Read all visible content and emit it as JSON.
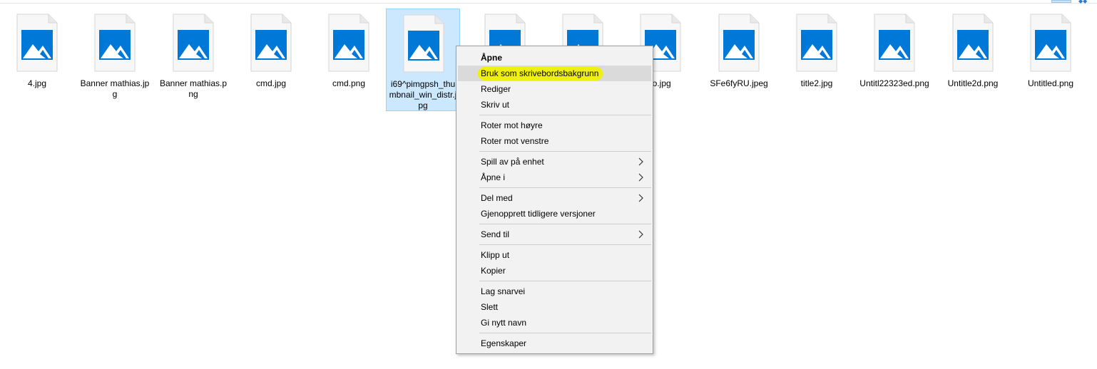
{
  "files": [
    {
      "name": "4.jpg"
    },
    {
      "name": "Banner mathias.jpg"
    },
    {
      "name": "Banner mathias.png"
    },
    {
      "name": "cmd.jpg"
    },
    {
      "name": "cmd.png"
    },
    {
      "name": "i69^pimgpsh_thumbnail_win_distr.jpg"
    },
    {
      "name": ""
    },
    {
      "name": ""
    },
    {
      "name": "to.jpg"
    },
    {
      "name": "SFe6fyRU.jpeg"
    },
    {
      "name": "title2.jpg"
    },
    {
      "name": "Untitl22323ed.png"
    },
    {
      "name": "Untitle2d.png"
    },
    {
      "name": "Untitled.png"
    }
  ],
  "menu": {
    "open": "Åpne",
    "set_wallpaper": "Bruk som skrivebordsbakgrunn",
    "edit": "Rediger",
    "print": "Skriv ut",
    "rotate_right": "Roter mot høyre",
    "rotate_left": "Roter mot venstre",
    "cast": "Spill av på enhet",
    "open_with": "Åpne i",
    "share": "Del med",
    "restore": "Gjenopprett tidligere versjoner",
    "send_to": "Send til",
    "cut": "Klipp ut",
    "copy": "Kopier",
    "shortcut": "Lag snarvei",
    "delete": "Slett",
    "rename": "Gi nytt navn",
    "properties": "Egenskaper"
  },
  "colors": {
    "icon_blue": "#0078d7",
    "selection": "#cce8ff",
    "highlight_marker": "#f0f010"
  }
}
